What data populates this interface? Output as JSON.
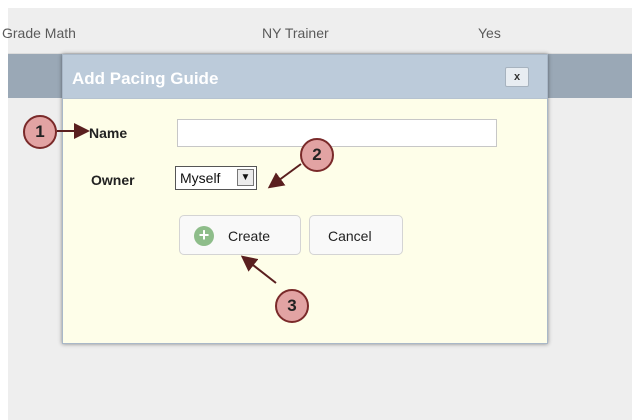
{
  "background_table": {
    "row1": {
      "col1": "Grade Math",
      "col2": "NY Trainer",
      "col3": "Yes"
    }
  },
  "dialog": {
    "title": "Add Pacing Guide",
    "close_label": "x",
    "fields": {
      "name_label": "Name",
      "name_value": "",
      "owner_label": "Owner",
      "owner_selected": "Myself"
    },
    "buttons": {
      "create_label": "Create",
      "cancel_label": "Cancel"
    }
  },
  "callouts": {
    "c1": "1",
    "c2": "2",
    "c3": "3"
  },
  "icons": {
    "close": "close-icon",
    "dropdown": "chevron-down-icon",
    "add": "plus-circle-icon",
    "callout_arrow": "arrow-icon"
  },
  "colors": {
    "titlebar": "#bccbda",
    "dialog_bg": "#fefee9",
    "callout_fill": "#e2a3a3",
    "callout_border": "#7a2a2a",
    "header_row": "#9aa8b6"
  }
}
